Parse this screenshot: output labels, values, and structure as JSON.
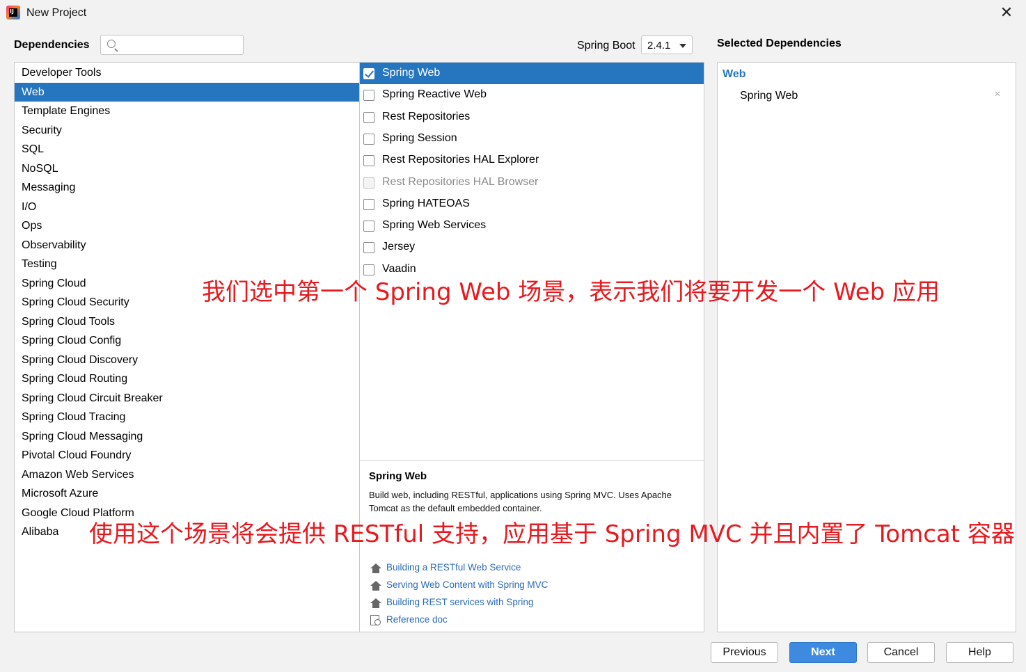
{
  "window": {
    "title": "New Project",
    "icon": "intellij-icon",
    "icon_text": "IJ"
  },
  "header": {
    "dependencies_label": "Dependencies",
    "search_value": "",
    "spring_boot_label": "Spring Boot",
    "spring_boot_version": "2.4.1",
    "selected_label": "Selected Dependencies"
  },
  "categories": [
    "Developer Tools",
    "Web",
    "Template Engines",
    "Security",
    "SQL",
    "NoSQL",
    "Messaging",
    "I/O",
    "Ops",
    "Observability",
    "Testing",
    "Spring Cloud",
    "Spring Cloud Security",
    "Spring Cloud Tools",
    "Spring Cloud Config",
    "Spring Cloud Discovery",
    "Spring Cloud Routing",
    "Spring Cloud Circuit Breaker",
    "Spring Cloud Tracing",
    "Spring Cloud Messaging",
    "Pivotal Cloud Foundry",
    "Amazon Web Services",
    "Microsoft Azure",
    "Google Cloud Platform",
    "Alibaba"
  ],
  "selected_category": "Web",
  "dependencies": [
    {
      "label": "Spring Web",
      "checked": true,
      "disabled": false
    },
    {
      "label": "Spring Reactive Web",
      "checked": false,
      "disabled": false
    },
    {
      "label": "Rest Repositories",
      "checked": false,
      "disabled": false
    },
    {
      "label": "Spring Session",
      "checked": false,
      "disabled": false
    },
    {
      "label": "Rest Repositories HAL Explorer",
      "checked": false,
      "disabled": false
    },
    {
      "label": "Rest Repositories HAL Browser",
      "checked": false,
      "disabled": true
    },
    {
      "label": "Spring HATEOAS",
      "checked": false,
      "disabled": false
    },
    {
      "label": "Spring Web Services",
      "checked": false,
      "disabled": false
    },
    {
      "label": "Jersey",
      "checked": false,
      "disabled": false
    },
    {
      "label": "Vaadin",
      "checked": false,
      "disabled": false
    }
  ],
  "description": {
    "title": "Spring Web",
    "text": "Build web, including RESTful, applications using Spring MVC. Uses Apache Tomcat as the default embedded container.",
    "links": [
      {
        "label": "Building a RESTful Web Service",
        "icon": "home-icon"
      },
      {
        "label": "Serving Web Content with Spring MVC",
        "icon": "home-icon"
      },
      {
        "label": "Building REST services with Spring",
        "icon": "home-icon"
      },
      {
        "label": "Reference doc",
        "icon": "reference-doc-icon"
      }
    ]
  },
  "selected": {
    "group": "Web",
    "items": [
      "Spring Web"
    ],
    "remove_glyph": "×"
  },
  "annotations": {
    "line1": "我们选中第一个 Spring Web 场景，表示我们将要开发一个 Web 应用",
    "line2": "使用这个场景将会提供 RESTful 支持，应用基于 Spring MVC 并且内置了 Tomcat 容器",
    "color": "#e8191e"
  },
  "buttons": {
    "previous": "Previous",
    "next": "Next",
    "cancel": "Cancel",
    "help": "Help"
  },
  "colors": {
    "selection": "#2675bf",
    "link": "#2a6bb8",
    "primary_button": "#3d8ae0"
  }
}
